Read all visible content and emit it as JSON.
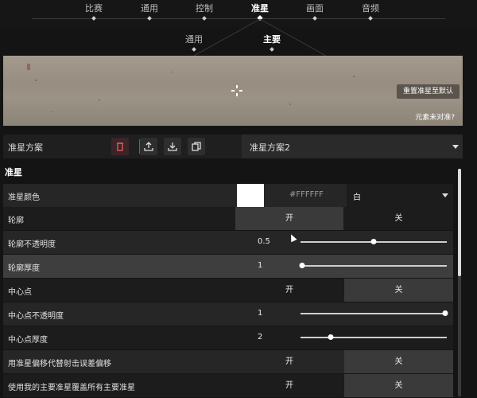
{
  "top_tabs": [
    "比赛",
    "通用",
    "控制",
    "准星",
    "画面",
    "音频"
  ],
  "top_active": "准星",
  "sub_tabs": [
    "通用",
    "主要"
  ],
  "sub_active": "主要",
  "preview": {
    "reset_label": "重置准星至默认",
    "unaligned_label": "元素未对准?"
  },
  "scheme": {
    "label": "准星方案",
    "selected": "准星方案2"
  },
  "section_title": "准星",
  "rows": {
    "color": {
      "label": "准星颜色",
      "hex": "#FFFFFF",
      "name": "白",
      "swatch": "#FFFFFF"
    },
    "outline": {
      "label": "轮廓",
      "on": "开",
      "off": "关"
    },
    "outline_opacity": {
      "label": "轮廓不透明度",
      "value": "0.5",
      "level": 0.5
    },
    "outline_thickness": {
      "label": "轮廓厚度",
      "value": "1",
      "level": 0.0
    },
    "center_dot": {
      "label": "中心点",
      "on": "开",
      "off": "关"
    },
    "center_dot_opacity": {
      "label": "中心点不透明度",
      "value": "1",
      "level": 1.0
    },
    "center_dot_thickness": {
      "label": "中心点厚度",
      "value": "2",
      "level": 0.2
    },
    "offset_override": {
      "label": "用准星偏移代替射击误差偏移",
      "on": "开",
      "off": "关"
    },
    "override_all": {
      "label": "使用我的主要准星覆盖所有主要准星",
      "on": "开",
      "off": "关"
    }
  },
  "icons": [
    "delete-icon",
    "export-icon",
    "import-icon",
    "copy-icon",
    "chevron-down-icon"
  ]
}
